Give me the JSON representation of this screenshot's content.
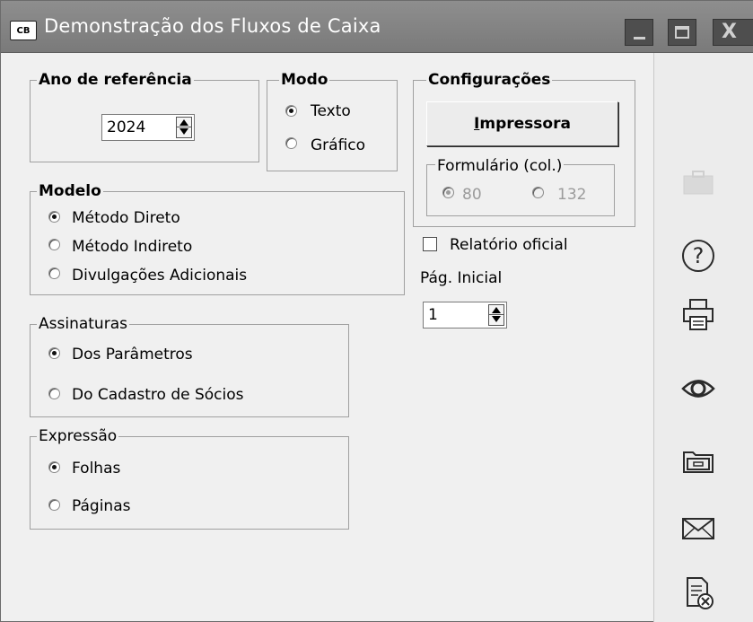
{
  "window": {
    "app_badge": "CB",
    "title": "Demonstração dos Fluxos de Caixa",
    "minimize": "_",
    "maximize": "□",
    "close": "X"
  },
  "ano_referencia": {
    "label": "Ano de referência",
    "value": "2024"
  },
  "modo": {
    "label": "Modo",
    "options": [
      "Texto",
      "Gráfico"
    ],
    "selected": "Texto"
  },
  "configuracoes": {
    "label": "Configurações",
    "printer_button_first": "I",
    "printer_button_rest": "mpressora",
    "formulario": {
      "label": "Formulário (col.)",
      "options": [
        "80",
        "132"
      ],
      "selected": "80",
      "enabled": false
    }
  },
  "modelo": {
    "label": "Modelo",
    "options": [
      "Método Direto",
      "Método Indireto",
      "Divulgações Adicionais"
    ],
    "selected": "Método Direto"
  },
  "relatorio_oficial": {
    "label": "Relatório oficial",
    "checked": false
  },
  "pag_inicial": {
    "label": "Pág. Inicial",
    "value": "1"
  },
  "assinaturas": {
    "label": "Assinaturas",
    "options": [
      "Dos Parâmetros",
      "Do Cadastro de Sócios"
    ],
    "selected": "Dos Parâmetros"
  },
  "expressao": {
    "label": "Expressão",
    "options": [
      "Folhas",
      "Páginas"
    ],
    "selected": "Folhas"
  },
  "sidebar_icons": [
    "briefcase-icon",
    "help-icon",
    "printer-icon",
    "preview-eye-icon",
    "folder-icon",
    "email-icon",
    "cancel-document-icon"
  ],
  "colors": {
    "titlebar": "#7a7a7a",
    "window_bg": "#f0f0f0",
    "sidebar_bg": "#ececec"
  }
}
